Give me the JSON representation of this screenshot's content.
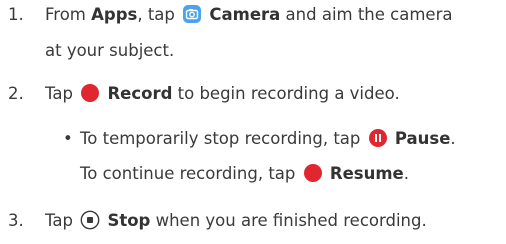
{
  "steps": [
    {
      "number": "1.",
      "line1": {
        "pre": "From ",
        "b1": "Apps",
        "mid": ", tap ",
        "b2": "Camera",
        "post": " and aim the camera"
      },
      "line2": "at your subject."
    },
    {
      "number": "2.",
      "pre": "Tap ",
      "bold": "Record",
      "post": " to begin recording a video."
    },
    {
      "bullet": "•",
      "line1": {
        "pre": "To temporarily stop recording, tap ",
        "bold": "Pause",
        "post": "."
      },
      "line2": {
        "pre": "To continue recording, tap ",
        "bold": "Resume",
        "post": "."
      }
    },
    {
      "number": "3.",
      "pre": "Tap ",
      "bold": "Stop",
      "post": " when you are finished recording."
    }
  ],
  "icons": {
    "camera": {
      "name": "camera-app-icon",
      "color": "#4aa3f0"
    },
    "record": {
      "name": "record-icon",
      "color": "#e0262f"
    },
    "pause": {
      "name": "pause-icon",
      "color": "#e0262f"
    },
    "resume": {
      "name": "resume-icon",
      "color": "#e0262f"
    },
    "stop": {
      "name": "stop-icon",
      "color": "#3a3a3a"
    }
  }
}
